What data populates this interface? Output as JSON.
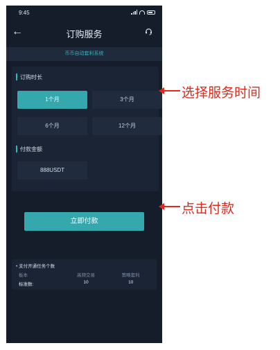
{
  "status_bar": {
    "time": "9:45"
  },
  "nav": {
    "back_icon": "arrow-left-icon",
    "title": "订购服务",
    "support_icon": "headset-icon"
  },
  "banner": {
    "text": "币币自动套利系统"
  },
  "subscription": {
    "label": "订购时长",
    "options": [
      {
        "label": "1个月",
        "selected": true
      },
      {
        "label": "3个月",
        "selected": false
      },
      {
        "label": "6个月",
        "selected": false
      },
      {
        "label": "12个月",
        "selected": false
      }
    ]
  },
  "payment": {
    "label": "付款金额",
    "amount": "888USDT"
  },
  "pay_button": {
    "label": "立即付款"
  },
  "tasks": {
    "title": "• 支付开通任务个数",
    "columns": [
      "板本",
      "高频交易",
      "策略套利"
    ],
    "rows": [
      [
        "标准数:",
        "10",
        "10"
      ]
    ]
  },
  "annotations": {
    "select_time": "选择服务时间",
    "click_pay": "点击付款"
  },
  "colors": {
    "accent": "#34a8ad",
    "annotation": "#e0281d",
    "background": "#151d2b"
  }
}
